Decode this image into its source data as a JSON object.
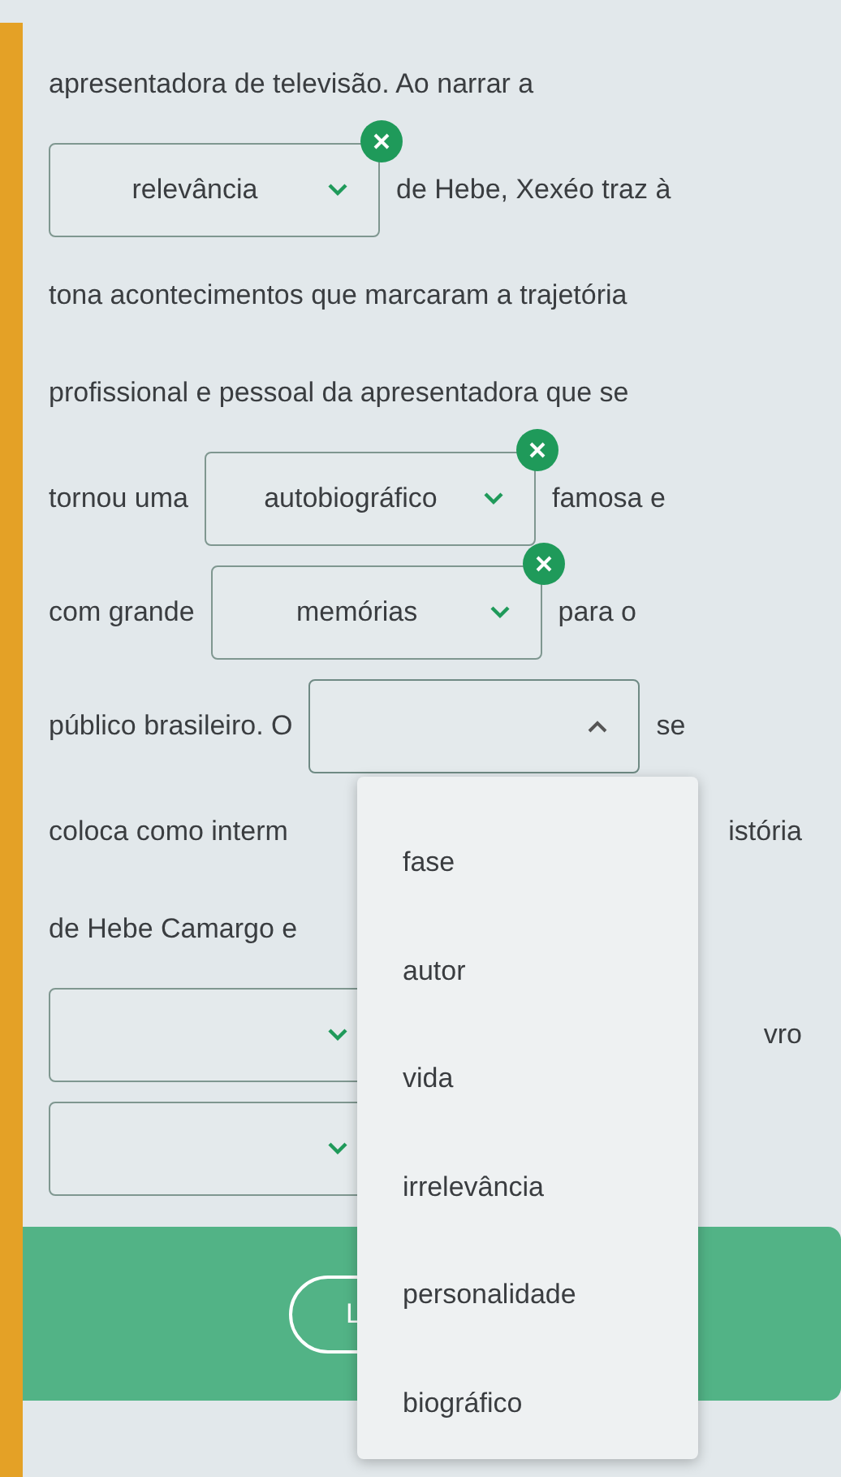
{
  "lines": [
    {
      "segments": [
        {
          "kind": "text",
          "text": "apresentadora de televisão. Ao narrar a"
        }
      ]
    },
    {
      "segments": [
        {
          "kind": "select",
          "value": "relevância",
          "clear": true,
          "expanded": false
        },
        {
          "kind": "text",
          "text": "de Hebe, Xexéo traz à"
        }
      ]
    },
    {
      "segments": [
        {
          "kind": "text",
          "text": "tona acontecimentos que marcaram a trajetória"
        }
      ]
    },
    {
      "segments": [
        {
          "kind": "text",
          "text": "profissional e pessoal da apresentadora que se"
        }
      ]
    },
    {
      "segments": [
        {
          "kind": "text",
          "text": "tornou uma"
        },
        {
          "kind": "select",
          "value": "autobiográfico",
          "clear": true,
          "expanded": false
        },
        {
          "kind": "text",
          "text": "famosa e"
        }
      ]
    },
    {
      "segments": [
        {
          "kind": "text",
          "text": "com grande"
        },
        {
          "kind": "select",
          "value": "memórias",
          "clear": true,
          "expanded": false
        },
        {
          "kind": "text",
          "text": "para o"
        }
      ]
    },
    {
      "segments": [
        {
          "kind": "text",
          "text": "público brasileiro. O"
        },
        {
          "kind": "select",
          "clear": false,
          "expanded": true
        },
        {
          "kind": "text",
          "text": "se"
        }
      ]
    },
    {
      "segments": [
        {
          "kind": "text",
          "text": "coloca como interm"
        },
        {
          "kind": "far_text",
          "text": "istória"
        }
      ]
    },
    {
      "segments": [
        {
          "kind": "text",
          "text": "de Hebe Camargo e"
        }
      ]
    },
    {
      "segments": [
        {
          "kind": "select",
          "expanded": false
        },
        {
          "kind": "far_text",
          "text": "vro"
        }
      ]
    },
    {
      "segments": [
        {
          "kind": "select",
          "expanded": false
        }
      ]
    }
  ],
  "menu": {
    "options": [
      "fase",
      "autor",
      "vida",
      "irrelevância",
      "personalidade",
      "biográfico"
    ]
  },
  "button": {
    "label": "L"
  }
}
